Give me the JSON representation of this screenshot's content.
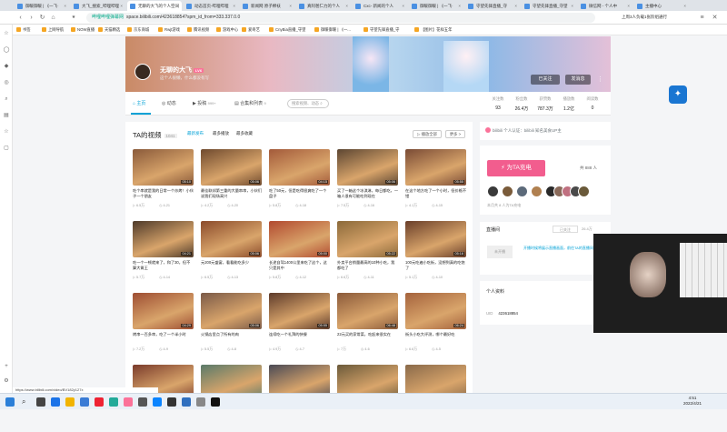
{
  "browser": {
    "tabs": [
      {
        "label": "御暖御暖 | 《一飞·"
      },
      {
        "label": "大飞_搜索_哔哩哔哩"
      },
      {
        "label": "无聊的大飞的个人空间"
      },
      {
        "label": "动态首页-哔哩哔哩"
      },
      {
        "label": "新闻网 原子棉袄"
      },
      {
        "label": "真阿爸仁力的个人"
      },
      {
        "label": "Cxc- 新闻的个人"
      },
      {
        "label": "御暖御暖 | 《一飞·"
      },
      {
        "label": "守望先锋直播_守"
      },
      {
        "label": "守望先锋直播_守望"
      },
      {
        "label": "微信网 - 个人中"
      },
      {
        "label": "主播中心"
      }
    ],
    "url": "space.bilibili.com/423618854?spm_id_from=333.337.0.0",
    "url_prefix": "哔哩哔哩弹幕网",
    "address_right": "上周3人负载1张阶组通行",
    "bookmarks": [
      "书签",
      "上网导航",
      "NOW直播",
      "天猫精选",
      "京东商城",
      "Rwjt游戏",
      "腾讯视频",
      "游戏中心",
      "爱奇艺",
      "CnyBia直播_守望",
      "御暖御暖 | 《一...",
      "守望先锋直播_守",
      "【图片】花样五年"
    ]
  },
  "profile": {
    "username": "无聊的大飞",
    "level": "LV6",
    "vip": "年度大会员",
    "sign": "这个人很懒，什么都没有写",
    "followed_btn": "已关注",
    "message_btn": "发消息",
    "more_btn": "⋮"
  },
  "nav": {
    "tabs": [
      {
        "label": "主页",
        "count": ""
      },
      {
        "label": "动态",
        "count": ""
      },
      {
        "label": "投稿",
        "count": "999+"
      },
      {
        "label": "合集和列表",
        "count": "9"
      }
    ],
    "search_placeholder": "搜索视频、动态",
    "stats": [
      {
        "label": "关注数",
        "value": "93"
      },
      {
        "label": "粉丝数",
        "value": "26.4万"
      },
      {
        "label": "获赞数",
        "value": "787.3万"
      },
      {
        "label": "播放数",
        "value": "1.2亿"
      },
      {
        "label": "阅读数",
        "value": "0"
      }
    ]
  },
  "videos": {
    "title": "TA的视频",
    "count": "1041",
    "sorts": [
      "最新发布",
      "最多播放",
      "最多收藏"
    ],
    "play_all": "▷ 播放全部",
    "more": "更多 >",
    "items": [
      {
        "title": "吃个串就是我的日常一个炒烤！小伙子一个朋友",
        "plays": "6.5万",
        "date": "4-21",
        "dur": "05:10",
        "color": "#8a5a3a"
      },
      {
        "title": "最佳联邦第三重的大量串串，小伙们说我们现场高兴",
        "plays": "4.2万",
        "date": "4-20",
        "dur": "05:06",
        "color": "#6f4a2e"
      },
      {
        "title": "吃了50元，但是吃得很爽吃了一个盘子",
        "plays": "5.8万",
        "date": "4-18",
        "dur": "04:15",
        "color": "#a35a3a"
      },
      {
        "title": "买了一箱这个冰淇淋，每日都吃，一箱人很有可能吃到现在",
        "plays": "7.5万",
        "date": "4-16",
        "dur": "05:06",
        "color": "#5c4632"
      },
      {
        "title": "在这个地方吃了一个小时，但价格不错",
        "plays": "4.1万",
        "date": "4-15",
        "dur": "05:55",
        "color": "#7a4b35"
      },
      {
        "title": "吃一个一顿就来了，和了30，但不算大胃王",
        "plays": "5.7万",
        "date": "4-14",
        "dur": "04:21",
        "color": "#4e3a2a"
      },
      {
        "title": "元200元盛宴，看看能吃多少",
        "plays": "6.5万",
        "date": "4-13",
        "dur": "05:06",
        "color": "#8b4b2b"
      },
      {
        "title": "长途自驾1400公里来吃了这个，这只是其中",
        "plays": "5.8万",
        "date": "4-12",
        "dur": "05:00",
        "color": "#b24a30"
      },
      {
        "title": "外卖平台销量最高的10种小吃，我都吃了",
        "plays": "6.6万",
        "date": "4-11",
        "dur": "05:22",
        "color": "#8c6a3a"
      },
      {
        "title": "100元吃遍小吃街，没想到真的吃饱了",
        "plays": "5.1万",
        "date": "4-10",
        "dur": "05:16",
        "color": "#6a3f2a"
      },
      {
        "title": "烤串一百多串，吃了一个半小时",
        "plays": "7.2万",
        "date": "4-9",
        "dur": "04:29",
        "color": "#9e4e33"
      },
      {
        "title": "火锅店里点了所有的肉",
        "plays": "5.5万",
        "date": "4-8",
        "dur": "05:06",
        "color": "#7b5a48"
      },
      {
        "title": "连续吃一个礼拜的快餐",
        "plays": "4.9万",
        "date": "4-7",
        "dur": "05:55",
        "color": "#5e3b2b"
      },
      {
        "title": "22元买的家常菜，吃起来很实在",
        "plays": "7万",
        "date": "4-6",
        "dur": "06:48",
        "color": "#8b5a3a"
      },
      {
        "title": "街头小吃大评测，哪个最好吃",
        "plays": "6.6万",
        "date": "4-5",
        "dur": "06:24",
        "color": "#a5633d"
      },
      {
        "title": "",
        "plays": "",
        "date": "",
        "dur": "",
        "color": "#7a3b2b"
      },
      {
        "title": "",
        "plays": "",
        "date": "",
        "dur": "",
        "color": "#5a7a6a"
      },
      {
        "title": "",
        "plays": "",
        "date": "",
        "dur": "",
        "color": "#4a4a55"
      },
      {
        "title": "",
        "plays": "",
        "date": "",
        "dur": "",
        "color": "#6b5a3a"
      },
      {
        "title": "",
        "plays": "",
        "date": "",
        "dur": "",
        "color": "#8a6a4a"
      }
    ]
  },
  "sidebar": {
    "cert": "bilibili 个人认证：bilibili 知名美食UP主",
    "charge_btn": "⚡ 为TA充电",
    "charge_count": "共 888 人",
    "charge_note": "本月共 8 人为TA充电",
    "live_title": "直播间",
    "live_followed": "已关注",
    "live_count": "26.4万",
    "live_status": "未开播",
    "live_note": "开播时候将展示直播画面，前往TA的直播间 >",
    "personal_title": "个人资料",
    "uid_label": "UID",
    "uid_value": "423618854"
  },
  "statusbar": "https://www.bilibili.com/video/BV182y127x",
  "clock": {
    "time": "4:51",
    "date": "2022/4/21"
  }
}
